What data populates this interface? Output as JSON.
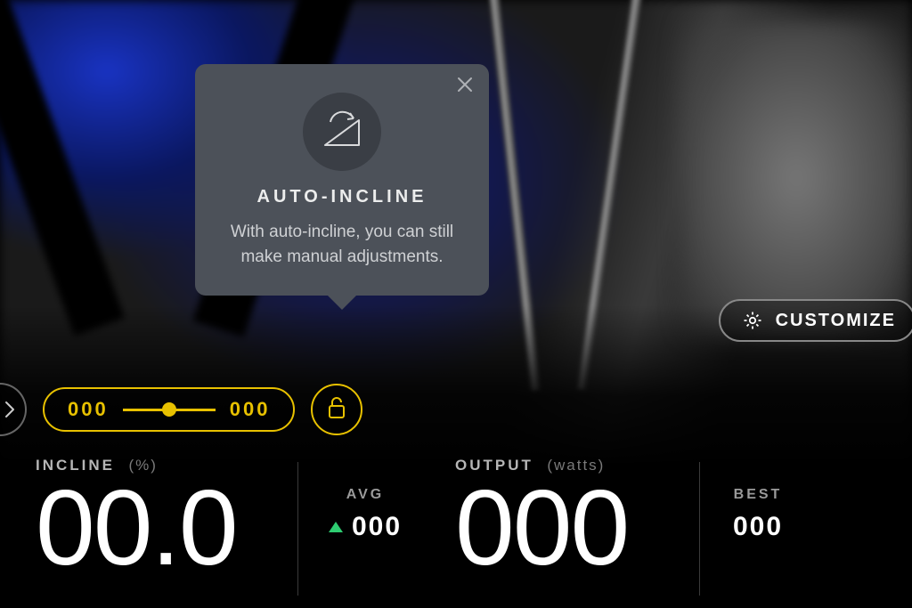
{
  "popover": {
    "title": "AUTO-INCLINE",
    "body": "With auto-incline, you can still make manual adjustments."
  },
  "customize": {
    "label": "CUSTOMIZE"
  },
  "slider": {
    "left_value": "000",
    "right_value": "000"
  },
  "metrics": {
    "incline": {
      "label": "INCLINE",
      "unit": "(%)",
      "value": "00.0"
    },
    "avg": {
      "label": "AVG",
      "value": "000"
    },
    "output": {
      "label": "OUTPUT",
      "unit": "(watts)",
      "value": "000"
    },
    "best": {
      "label": "BEST",
      "value": "000"
    }
  }
}
